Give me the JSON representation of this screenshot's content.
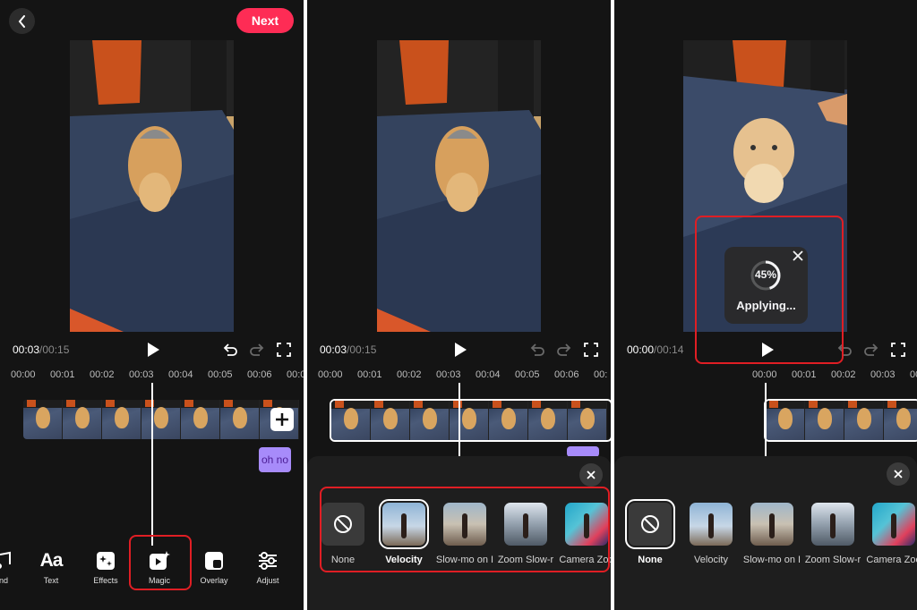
{
  "colors": {
    "accent": "#fe2c55",
    "highlight": "#e01e24",
    "clip": "#a78bfa"
  },
  "panel1": {
    "next_label": "Next",
    "time_current": "00:03",
    "time_total": "/00:15",
    "ruler": [
      "00:00",
      "00:01",
      "00:02",
      "00:03",
      "00:04",
      "00:05",
      "00:06",
      "00:0"
    ],
    "text_clip": "oh no",
    "tools": [
      {
        "label": "nd",
        "icon": "music-icon"
      },
      {
        "label": "Text",
        "icon": "text-icon",
        "glyph": "Aa"
      },
      {
        "label": "Effects",
        "icon": "effects-icon"
      },
      {
        "label": "Magic",
        "icon": "magic-icon"
      },
      {
        "label": "Overlay",
        "icon": "overlay-icon"
      },
      {
        "label": "Adjust",
        "icon": "adjust-icon"
      }
    ]
  },
  "panel2": {
    "time_current": "00:03",
    "time_total": "/00:15",
    "ruler": [
      "00:00",
      "00:01",
      "00:02",
      "00:03",
      "00:04",
      "00:05",
      "00:06",
      "00:"
    ],
    "effects": [
      {
        "label": "None",
        "icon": "no-effect-icon"
      },
      {
        "label": "Velocity",
        "selected": true
      },
      {
        "label": "Slow-mo on I"
      },
      {
        "label": "Zoom Slow-r"
      },
      {
        "label": "Camera Zoo"
      }
    ]
  },
  "panel3": {
    "time_current": "00:00",
    "time_total": "/00:14",
    "ruler": [
      "00:00",
      "00:01",
      "00:02",
      "00:03",
      "00:"
    ],
    "progress_percent": 45,
    "progress_label": "45%",
    "status_label": "Applying...",
    "effects": [
      {
        "label": "None",
        "selected": true,
        "icon": "no-effect-icon"
      },
      {
        "label": "Velocity"
      },
      {
        "label": "Slow-mo on I"
      },
      {
        "label": "Zoom Slow-r"
      },
      {
        "label": "Camera Zoo"
      }
    ]
  }
}
